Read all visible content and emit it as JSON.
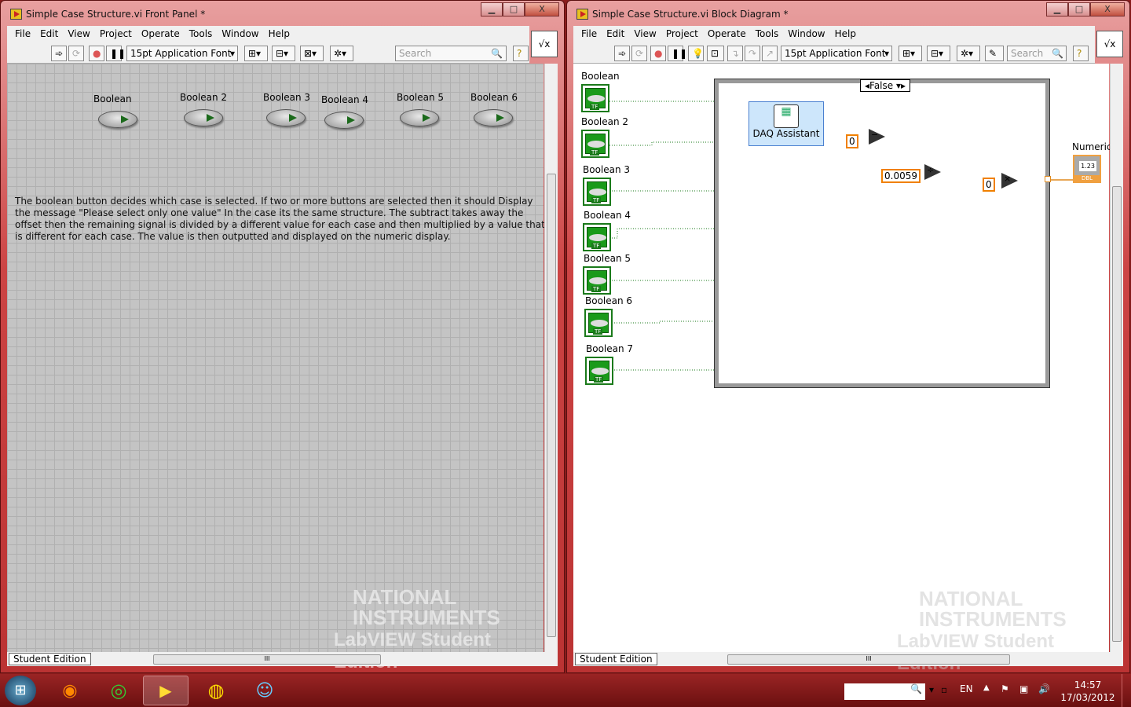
{
  "front_panel": {
    "title": "Simple Case Structure.vi Front Panel *",
    "menu": [
      "File",
      "Edit",
      "View",
      "Project",
      "Operate",
      "Tools",
      "Window",
      "Help"
    ],
    "font": "15pt Application Font",
    "search_placeholder": "Search",
    "booleans": [
      "Boolean",
      "Boolean 2",
      "Boolean 3",
      "Boolean 4",
      "Boolean 5",
      "Boolean 6"
    ],
    "description": "The boolean button decides which case is selected. If two or more buttons are selected then it should Display the message \"Please select only one value\" In the case its the same structure. The subtract takes away the offset then the remaining signal is divided by a different value for each case and then multiplied by a value that is different for each case. The value is then outputted and displayed on the numeric display.",
    "status": "Student Edition",
    "watermark": {
      "line1": "NATIONAL",
      "line2": "INSTRUMENTS",
      "line3": "LabVIEW Student Edition"
    }
  },
  "block_diagram": {
    "title": "Simple Case Structure.vi Block Diagram *",
    "menu": [
      "File",
      "Edit",
      "View",
      "Project",
      "Operate",
      "Tools",
      "Window",
      "Help"
    ],
    "font": "15pt Application Font",
    "search_placeholder": "Search",
    "terminals": [
      "Boolean",
      "Boolean 2",
      "Boolean 3",
      "Boolean 4",
      "Boolean 5",
      "Boolean 6",
      "Boolean 7"
    ],
    "terminal_type": "TF",
    "case_selector": "False",
    "daq": "DAQ Assistant",
    "constants": {
      "offset": "0",
      "divisor": "0.0059",
      "multiplier": "0"
    },
    "ops": {
      "subtract": "−",
      "divide": "÷",
      "multiply": "×"
    },
    "numeric": {
      "label": "Numeric",
      "value": "1.23",
      "type": "DBL"
    },
    "status": "Student Edition"
  },
  "taskbar": {
    "lang": "EN",
    "time": "14:57",
    "date": "17/03/2012"
  },
  "scroll_grip": "III"
}
